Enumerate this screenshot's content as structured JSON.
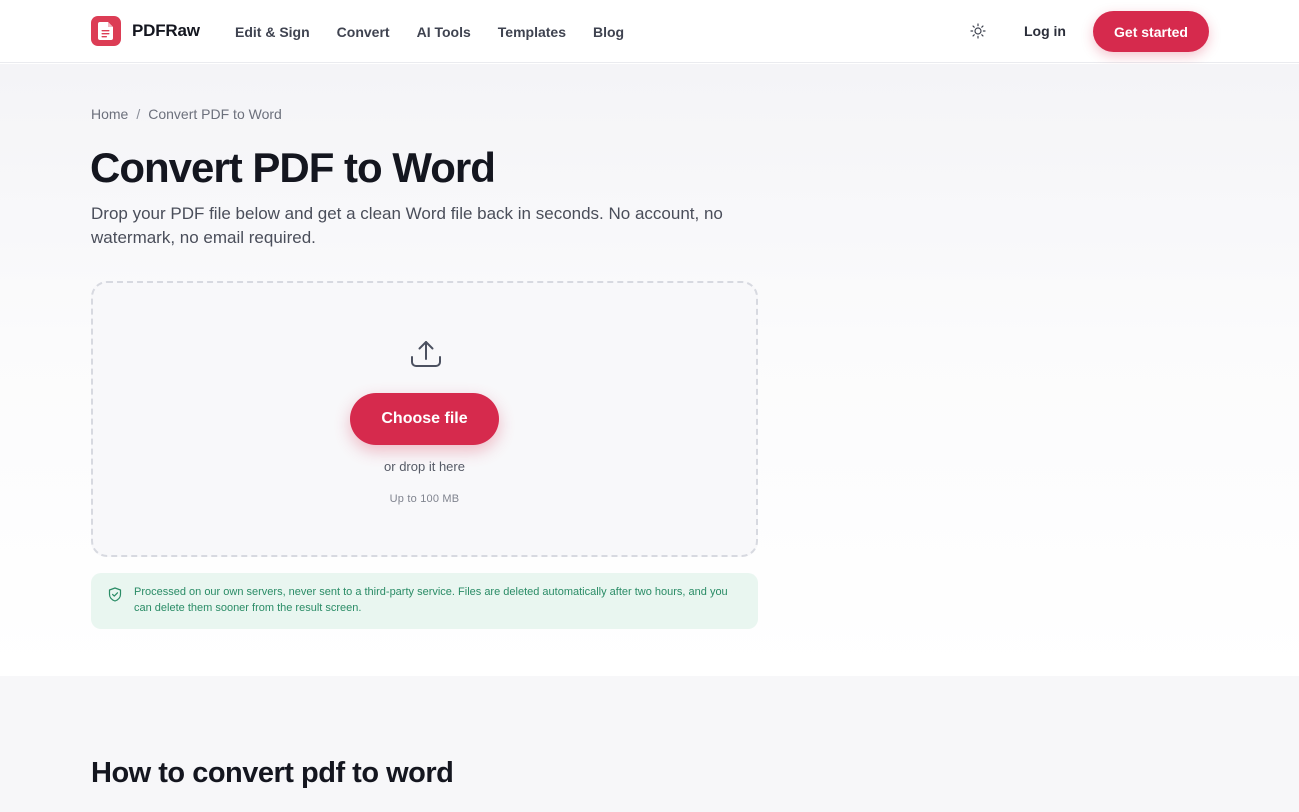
{
  "header": {
    "brand": "PDFRaw",
    "nav": [
      "Edit & Sign",
      "Convert",
      "AI Tools",
      "Templates",
      "Blog"
    ],
    "login": "Log in",
    "cta": "Get started"
  },
  "breadcrumb": {
    "home": "Home",
    "separator": "/",
    "current": "Convert PDF to Word"
  },
  "hero": {
    "title": "Convert PDF to Word",
    "subtitle": "Drop your PDF file below and get a clean Word file back in seconds. No account, no watermark, no email required."
  },
  "dropzone": {
    "button": "Choose file",
    "hint": "or drop it here",
    "limit": "Up to 100 MB"
  },
  "privacy": {
    "text": "Processed on our own servers, never sent to a third-party service. Files are deleted automatically after two hours, and you can delete them sooner from the result screen."
  },
  "howto": {
    "title": "How to convert pdf to word"
  },
  "icons": {
    "logo": "document-icon",
    "theme": "sun-icon",
    "upload": "upload-icon",
    "privacy": "shield-check-icon"
  },
  "colors": {
    "accent": "#d62a4d",
    "logo": "#dc3d55",
    "success_bg": "#e9f6f0",
    "success_text": "#2a8c66"
  }
}
